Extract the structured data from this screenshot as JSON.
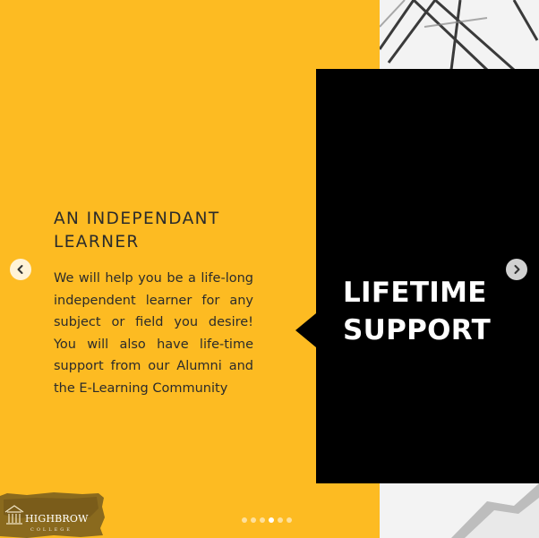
{
  "slide": {
    "heading": "AN INDEPENDANT LEARNER",
    "body": "We will help you be a life-long independent learner for any subject or field you desire! You will also have life-time support from our Alumni and the E-Learning Community",
    "feature_title": "LIFETIME SUPPORT"
  },
  "brand": {
    "logo_text": "HIGHBROW",
    "logo_subtext": "COLLEGE"
  },
  "carousel": {
    "prev_icon": "chevron-left-icon",
    "next_icon": "chevron-right-icon",
    "dot_count": 6,
    "active_index": 3
  },
  "colors": {
    "accent_yellow": "#FDBB22",
    "panel_black": "#000000",
    "text_dark": "#2b2b2b"
  }
}
